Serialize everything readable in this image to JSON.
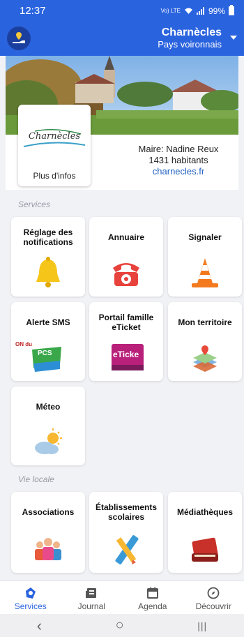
{
  "status_bar": {
    "time": "12:37",
    "network": "Vo) LTE",
    "battery": "99%"
  },
  "header": {
    "commune_name": "Charnècles",
    "region": "Pays voironnais"
  },
  "commune_info": {
    "logo_text": "Charnècles",
    "more_info_label": "Plus d'infos",
    "mayor": "Maire: Nadine Reux",
    "population": "1431 habitants",
    "website": "charnecles.fr"
  },
  "sections": {
    "services_title": "Services",
    "vie_locale_title": "Vie locale"
  },
  "services": [
    {
      "label": "Réglage des notifications",
      "icon": "bell-icon"
    },
    {
      "label": "Annuaire",
      "icon": "telephone-icon"
    },
    {
      "label": "Signaler",
      "icon": "traffic-cone-icon"
    },
    {
      "label": "Alerte SMS",
      "icon": "pcs-sms-icon",
      "badge": "ON du",
      "badge2": "PCS"
    },
    {
      "label": "Portail famille eTicket",
      "icon": "eticket-icon",
      "badge": "eTicke"
    },
    {
      "label": "Mon territoire",
      "icon": "map-layers-icon"
    },
    {
      "label": "Méteo",
      "icon": "weather-icon"
    }
  ],
  "vie_locale": [
    {
      "label": "Associations",
      "icon": "people-icon"
    },
    {
      "label": "Établissements scolaires",
      "icon": "ruler-pencil-icon"
    },
    {
      "label": "Médiathèques",
      "icon": "books-icon"
    }
  ],
  "bottom_nav": [
    {
      "label": "Services",
      "icon": "services-icon",
      "active": true
    },
    {
      "label": "Journal",
      "icon": "journal-icon",
      "active": false
    },
    {
      "label": "Agenda",
      "icon": "calendar-icon",
      "active": false
    },
    {
      "label": "Découvrir",
      "icon": "compass-icon",
      "active": false
    }
  ],
  "system_nav": {
    "back": "‹",
    "home": "○",
    "recents": "|||"
  },
  "colors": {
    "primary": "#2a63de",
    "background": "#f1f2f6"
  }
}
